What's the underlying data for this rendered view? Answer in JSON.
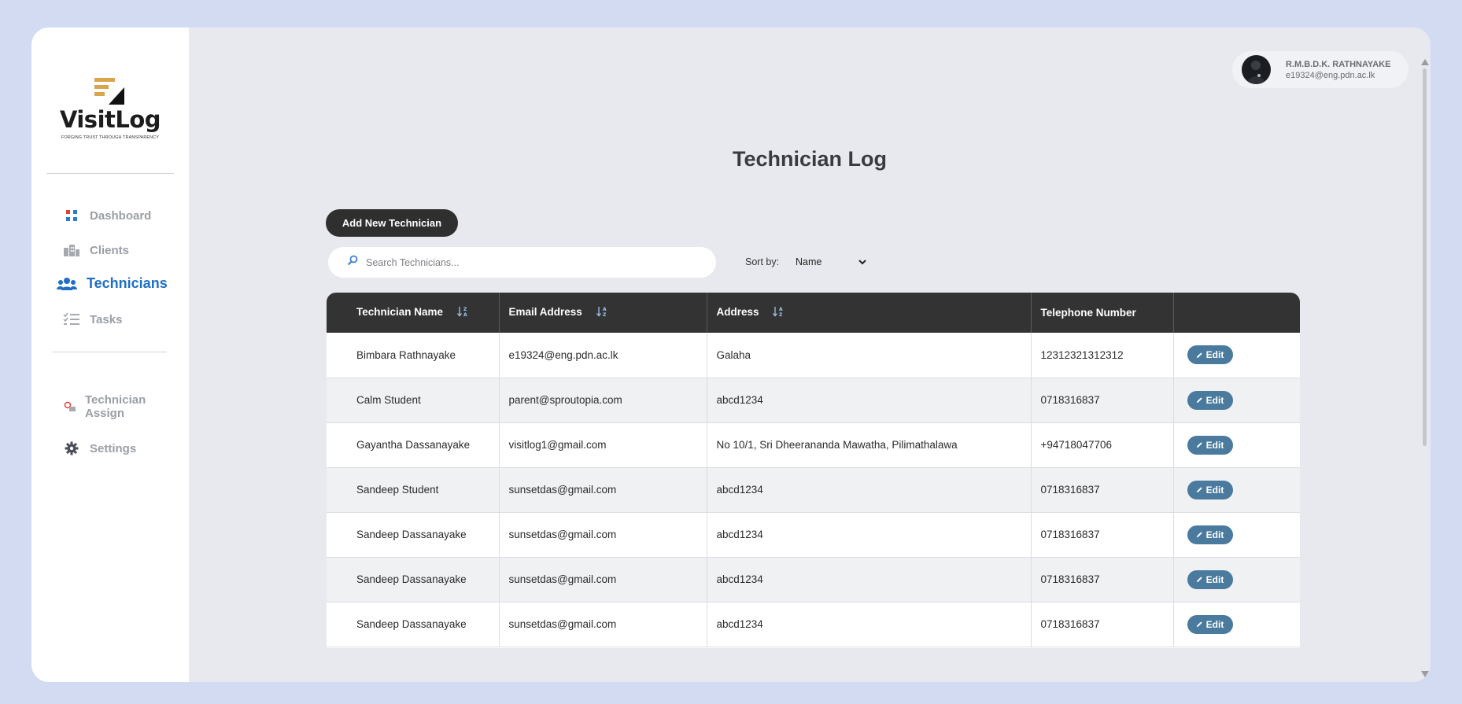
{
  "brand": {
    "name": "VisitLog",
    "tagline": "FORGING TRUST THROUGH TRANSPARENCY"
  },
  "sidebar": {
    "items": [
      {
        "label": "Dashboard",
        "icon": "dashboard-icon"
      },
      {
        "label": "Clients",
        "icon": "building-icon"
      },
      {
        "label": "Technicians",
        "icon": "users-icon",
        "active": true
      },
      {
        "label": "Tasks",
        "icon": "checklist-icon"
      }
    ],
    "secondary": [
      {
        "label": "Technician Assign",
        "icon": "assign-icon"
      },
      {
        "label": "Settings",
        "icon": "gear-icon"
      }
    ]
  },
  "user": {
    "name": "R.M.B.D.K. RATHNAYAKE",
    "email": "e19324@eng.pdn.ac.lk"
  },
  "page": {
    "title": "Technician Log",
    "add_button": "Add New Technician",
    "search_placeholder": "Search Technicians...",
    "sort_label": "Sort by:",
    "sort_value": "Name"
  },
  "table": {
    "headers": [
      "Technician Name",
      "Email Address",
      "Address",
      "Telephone Number",
      ""
    ],
    "edit_label": "Edit",
    "rows": [
      [
        "Bimbara Rathnayake",
        "e19324@eng.pdn.ac.lk",
        "Galaha",
        "12312321312312"
      ],
      [
        "Calm Student",
        "parent@sproutopia.com",
        "abcd1234",
        "0718316837"
      ],
      [
        "Gayantha Dassanayake",
        "visitlog1@gmail.com",
        "No 10/1, Sri Dheerananda Mawatha, Pilimathalawa",
        "+94718047706"
      ],
      [
        "Sandeep Student",
        "sunsetdas@gmail.com",
        "abcd1234",
        "0718316837"
      ],
      [
        "Sandeep Dassanayake",
        "sunsetdas@gmail.com",
        "abcd1234",
        "0718316837"
      ],
      [
        "Sandeep Dassanayake",
        "sunsetdas@gmail.com",
        "abcd1234",
        "0718316837"
      ],
      [
        "Sandeep Dassanayake",
        "sunsetdas@gmail.com",
        "abcd1234",
        "0718316837"
      ]
    ]
  },
  "colors": {
    "background": "#d3dbf3",
    "accent": "#1f6fc4",
    "header_dark": "#333333",
    "edit_button": "#4a7a9e",
    "logo_gold": "#d9a44b"
  }
}
